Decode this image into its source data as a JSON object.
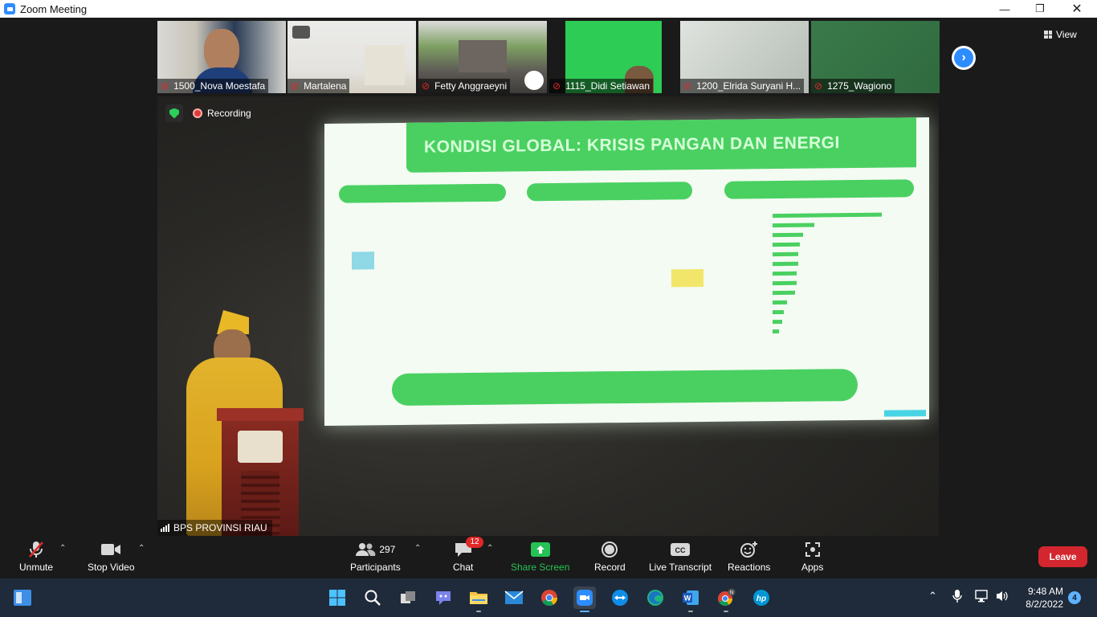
{
  "window": {
    "title": "Zoom Meeting",
    "controls": [
      "minimize",
      "restore",
      "close"
    ]
  },
  "gallery": {
    "participants": [
      {
        "name": "1500_Nova Moestafa",
        "muted": true
      },
      {
        "name": "Martalena",
        "muted": true
      },
      {
        "name": "Fetty Anggraeyni",
        "muted": true
      },
      {
        "name": "1115_Didi Setiawan",
        "muted": true
      },
      {
        "name": "1200_Elrida Suryani H...",
        "muted": true
      },
      {
        "name": "1275_Wagiono",
        "muted": true
      }
    ],
    "view_label": "View"
  },
  "main_video": {
    "recording_label": "Recording",
    "speaker_name": "BPS PROVINSI RIAU",
    "slide": {
      "title": "KONDISI GLOBAL: KRISIS PANGAN DAN ENERGI"
    }
  },
  "toolbar": {
    "unmute": "Unmute",
    "stop_video": "Stop Video",
    "participants": "Participants",
    "participants_count": "297",
    "chat": "Chat",
    "chat_badge": "12",
    "share_screen": "Share Screen",
    "record": "Record",
    "live_transcript": "Live Transcript",
    "reactions": "Reactions",
    "apps": "Apps",
    "leave": "Leave"
  },
  "taskbar": {
    "time": "9:48 AM",
    "date": "8/2/2022",
    "notifications": "4",
    "apps": [
      "start",
      "search",
      "task-view",
      "teams-chat",
      "file-explorer",
      "mail",
      "chrome",
      "zoom",
      "teamviewer",
      "edge",
      "word",
      "chrome-profile",
      "hp"
    ]
  },
  "colors": {
    "zoom_blue": "#2d8cff",
    "leave_red": "#d4262e",
    "share_green": "#25c255",
    "slide_green": "#4ad061"
  }
}
